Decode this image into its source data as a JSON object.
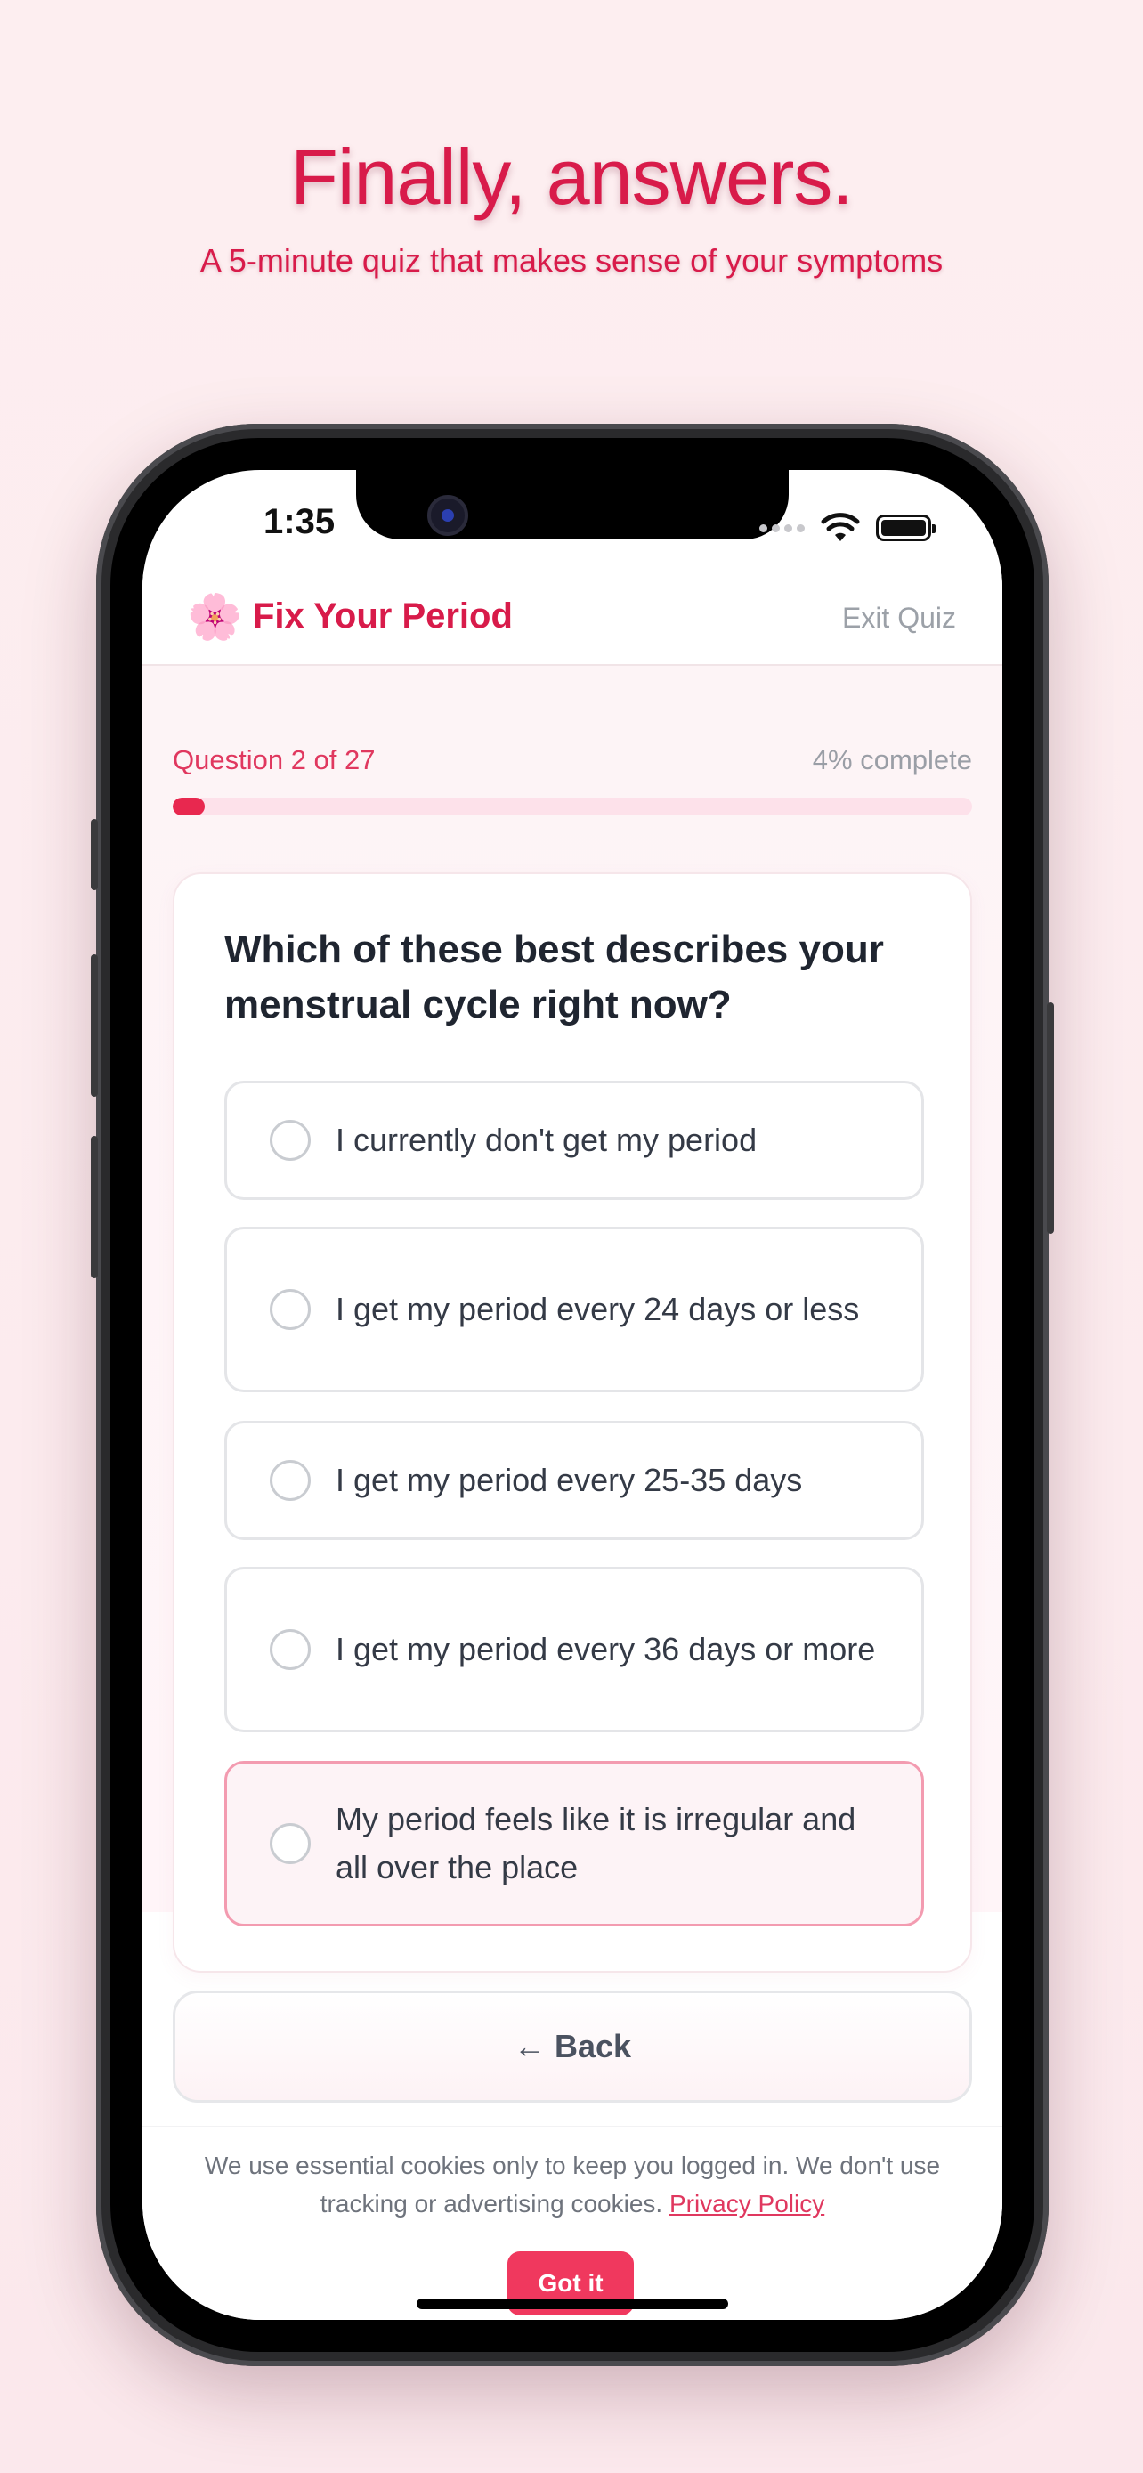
{
  "hero": {
    "title": "Finally, answers.",
    "subtitle": "A 5-minute quiz that makes sense of your symptoms"
  },
  "status_bar": {
    "time": "1:35",
    "icons": [
      "cellular-dots-icon",
      "wifi-icon",
      "battery-icon"
    ]
  },
  "header": {
    "logo_icon": "flower-icon",
    "logo_glyph": "🌸",
    "brand": "Fix Your Period",
    "exit_label": "Exit Quiz"
  },
  "progress": {
    "question_label": "Question 2 of 27",
    "percent_label": "4% complete",
    "fraction": 0.04
  },
  "question": {
    "text": "Which of these best describes your menstrual cycle right now?",
    "options": [
      {
        "label": "I currently don't get my period",
        "selected": false
      },
      {
        "label": "I get my period every 24 days or less",
        "selected": false
      },
      {
        "label": "I get my period every 25-35 days",
        "selected": false
      },
      {
        "label": "I get my period every 36 days or more",
        "selected": false
      },
      {
        "label": "My period feels like it is irregular and all over the place",
        "selected": false,
        "highlighted": true
      }
    ]
  },
  "back_button": {
    "label": "← Back"
  },
  "cookie_banner": {
    "text": "We use essential cookies only to keep you logged in. We don't use tracking or advertising cookies.",
    "link_label": "Privacy Policy",
    "button_label": "Got it"
  },
  "colors": {
    "accent": "#d81b4a",
    "button": "#f0385e",
    "progress_track": "#fde1ea",
    "highlight_border": "#f39bb0"
  }
}
